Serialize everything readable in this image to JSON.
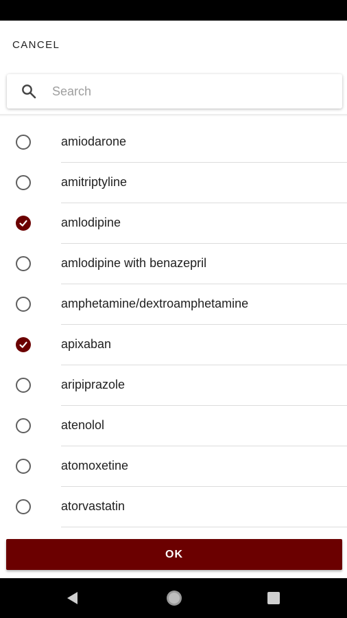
{
  "header": {
    "cancel_label": "CANCEL"
  },
  "search": {
    "placeholder": "Search",
    "value": ""
  },
  "list": {
    "items": [
      {
        "label": "amiodarone",
        "checked": false
      },
      {
        "label": "amitriptyline",
        "checked": false
      },
      {
        "label": "amlodipine",
        "checked": true
      },
      {
        "label": "amlodipine with benazepril",
        "checked": false
      },
      {
        "label": "amphetamine/dextroamphetamine",
        "checked": false
      },
      {
        "label": "apixaban",
        "checked": true
      },
      {
        "label": "aripiprazole",
        "checked": false
      },
      {
        "label": "atenolol",
        "checked": false
      },
      {
        "label": "atomoxetine",
        "checked": false
      },
      {
        "label": "atorvastatin",
        "checked": false
      }
    ]
  },
  "footer": {
    "ok_label": "OK"
  },
  "colors": {
    "accent": "#6b0000",
    "status_bar": "#000000",
    "nav_bar": "#000000",
    "placeholder": "#9e9e9e"
  },
  "icons": {
    "search": "search-icon",
    "check": "check-icon",
    "nav_back": "nav-back-icon",
    "nav_home": "nav-home-icon",
    "nav_recents": "nav-recents-icon"
  }
}
